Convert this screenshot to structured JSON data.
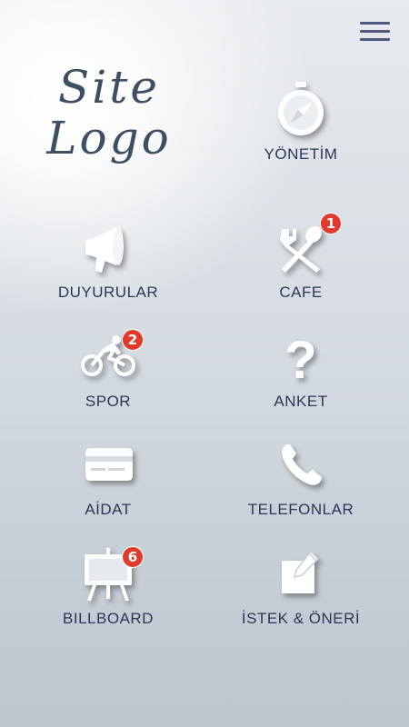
{
  "logo": {
    "line1": "Site",
    "line2": "Logo"
  },
  "menu": {
    "icon": "hamburger-icon"
  },
  "tiles": {
    "yonetim": {
      "label": "YÖNETİM",
      "icon": "compass-icon"
    },
    "duyurular": {
      "label": "DUYURULAR",
      "icon": "megaphone-icon"
    },
    "cafe": {
      "label": "CAFE",
      "icon": "fork-spoon-icon",
      "badge": "1"
    },
    "spor": {
      "label": "SPOR",
      "icon": "cyclist-icon",
      "badge": "2"
    },
    "anket": {
      "label": "ANKET",
      "icon": "question-icon"
    },
    "aidat": {
      "label": "AİDAT",
      "icon": "credit-card-icon"
    },
    "telefonlar": {
      "label": "TELEFONLAR",
      "icon": "phone-icon"
    },
    "billboard": {
      "label": "BILLBOARD",
      "icon": "easel-board-icon",
      "badge": "6"
    },
    "istek": {
      "label": "İSTEK & ÖNERİ",
      "icon": "edit-note-icon"
    }
  },
  "colors": {
    "label": "#2d3759",
    "badge": "#e03a2c",
    "menu": "#4f5a7e",
    "logo": "#3d4f63"
  }
}
